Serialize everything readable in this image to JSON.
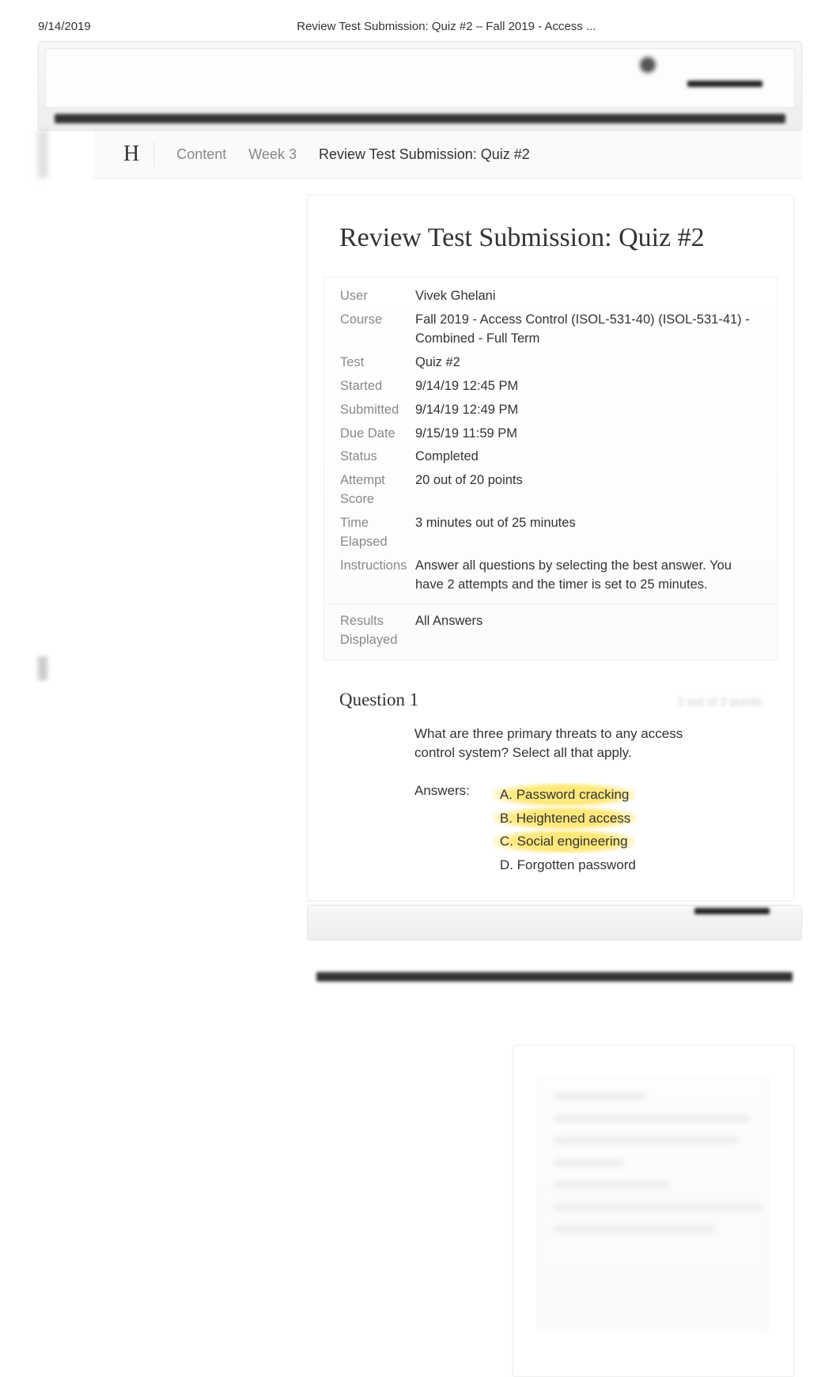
{
  "header": {
    "date": "9/14/2019",
    "doc_title": "Review Test Submission: Quiz #2 – Fall 2019 - Access ..."
  },
  "breadcrumb": {
    "home": "H",
    "content": "Content",
    "week": "Week 3",
    "current": "Review Test Submission: Quiz #2"
  },
  "panel": {
    "title": "Review Test Submission: Quiz #2"
  },
  "info": {
    "user_label": "User",
    "user_value": "Vivek Ghelani",
    "course_label": "Course",
    "course_value": "Fall 2019 - Access Control (ISOL-531-40) (ISOL-531-41) - Combined - Full Term",
    "test_label": "Test",
    "test_value": "Quiz #2",
    "started_label": "Started",
    "started_value": "9/14/19 12:45 PM",
    "submitted_label": "Submitted",
    "submitted_value": "9/14/19 12:49 PM",
    "due_label": "Due Date",
    "due_value": "9/15/19 11:59 PM",
    "status_label": "Status",
    "status_value": "Completed",
    "score_label": "Attempt Score",
    "score_value": "20 out of 20 points",
    "elapsed_label": "Time Elapsed",
    "elapsed_value": "3 minutes out of 25 minutes",
    "instructions_label": "Instructions",
    "instructions_value": "Answer all questions by selecting the best answer. You have 2 attempts and the timer is set to 25 minutes.",
    "results_label": "Results Displayed",
    "results_value": "All Answers"
  },
  "question1": {
    "title": "Question 1",
    "points": "2 out of 2 points",
    "text": "What are three primary threats to any access control system? Select all that apply.",
    "answers_label": "Answers:",
    "options": {
      "a": "A. Password cracking",
      "b": "B. Heightened access",
      "c": "C. Social engineering",
      "d": "D. Forgotten password"
    }
  }
}
